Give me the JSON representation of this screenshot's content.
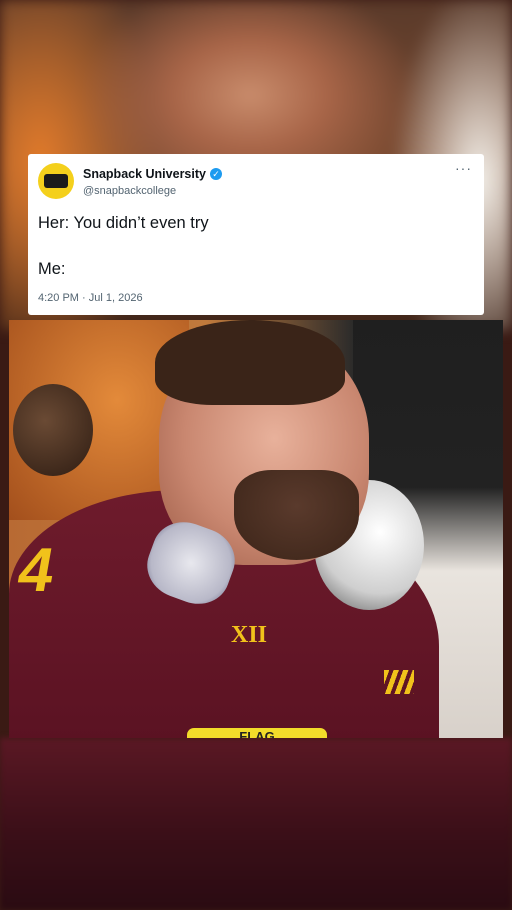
{
  "tweet": {
    "account_name": "Snapback University",
    "handle": "@snapbackcollege",
    "more_icon": "more-horizontal-icon",
    "line1": "Her: You didn’t even try",
    "line2": "Me:",
    "timestamp": "4:20 PM · Jul 1, 2026",
    "verified_color": "#1d9bf0"
  },
  "photo": {
    "jersey_number": "4",
    "patch_text": "XII",
    "banner_text": "FLAG"
  },
  "colors": {
    "jersey": "#6e1b2c",
    "accent": "#f1c21b"
  }
}
